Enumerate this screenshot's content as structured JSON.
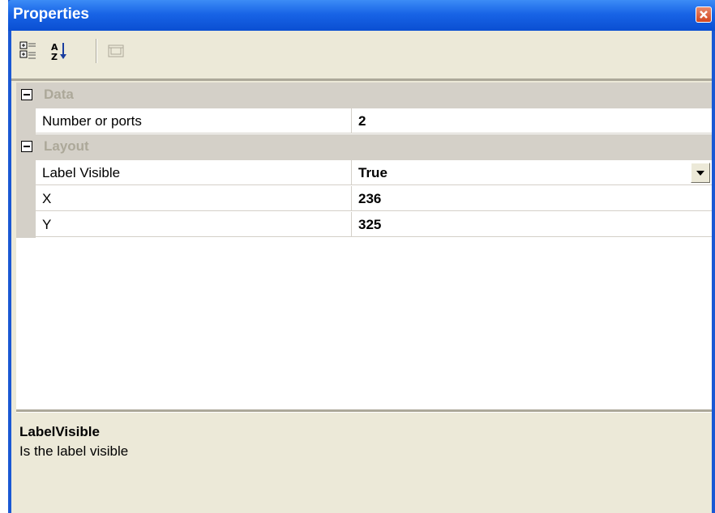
{
  "window": {
    "title": "Properties"
  },
  "toolbar": {
    "buttons": [
      {
        "icon": "categorized-icon"
      },
      {
        "icon": "sort-alphabetical-icon"
      },
      {
        "icon": "property-pages-icon"
      }
    ]
  },
  "categories": [
    {
      "label": "Data",
      "properties": [
        {
          "name": "Number or ports",
          "value": "2"
        }
      ]
    },
    {
      "label": "Layout",
      "properties": [
        {
          "name": "Label Visible",
          "value": "True",
          "dropdown": true
        },
        {
          "name": "X",
          "value": "236"
        },
        {
          "name": "Y",
          "value": "325"
        }
      ]
    }
  ],
  "description": {
    "title": "LabelVisible",
    "text": "Is the label visible"
  },
  "colors": {
    "titlebar": "#0a4fd2",
    "category_row": "#d4d0c8",
    "panel": "#ece9d8"
  }
}
